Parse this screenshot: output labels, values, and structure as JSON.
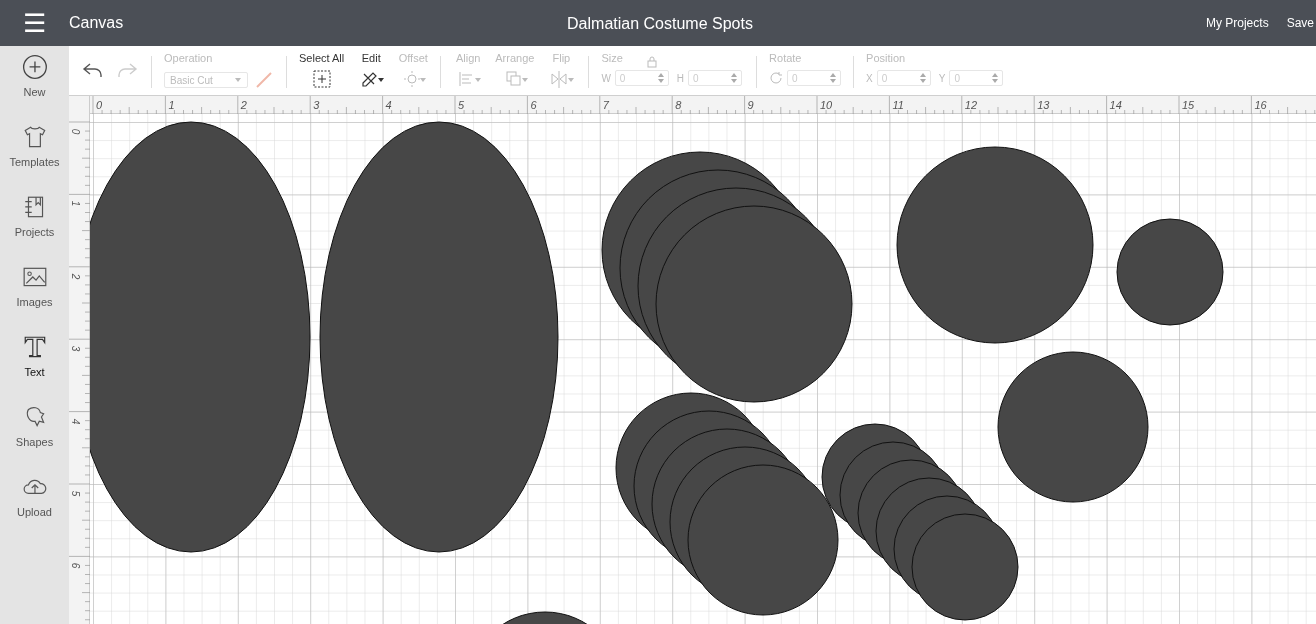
{
  "header": {
    "menu_icon": "☰",
    "section": "Canvas",
    "title": "Dalmatian Costume Spots",
    "links": [
      "My Projects",
      "Save"
    ]
  },
  "sidebar": {
    "items": [
      {
        "label": "New",
        "kind": "new",
        "selected": false
      },
      {
        "label": "Templates",
        "kind": "templates",
        "selected": false
      },
      {
        "label": "Projects",
        "kind": "projects",
        "selected": false
      },
      {
        "label": "Images",
        "kind": "images",
        "selected": false
      },
      {
        "label": "Text",
        "kind": "text",
        "selected": true
      },
      {
        "label": "Shapes",
        "kind": "shapes",
        "selected": false
      },
      {
        "label": "Upload",
        "kind": "upload",
        "selected": false
      }
    ]
  },
  "toolbar": {
    "operation": {
      "label": "Operation",
      "value": "Basic Cut",
      "disabled": true
    },
    "tools": [
      {
        "label": "Select All",
        "kind": "selectall",
        "disabled": false
      },
      {
        "label": "Edit",
        "kind": "edit",
        "disabled": false
      },
      {
        "label": "Offset",
        "kind": "offset",
        "disabled": true
      }
    ],
    "arrange": [
      {
        "label": "Align",
        "kind": "align",
        "disabled": true
      },
      {
        "label": "Arrange",
        "kind": "arrange",
        "disabled": true
      },
      {
        "label": "Flip",
        "kind": "flip",
        "disabled": true
      }
    ],
    "size": {
      "label": "Size",
      "fields": [
        {
          "label": "W",
          "value": "0"
        },
        {
          "label": "H",
          "value": "0"
        }
      ]
    },
    "rotate": {
      "label": "Rotate",
      "value": "0"
    },
    "position": {
      "label": "Position",
      "fields": [
        {
          "label": "X",
          "value": "0"
        },
        {
          "label": "Y",
          "value": "0"
        }
      ]
    }
  },
  "ruler": {
    "horizontal": [
      "0",
      "1",
      "2",
      "3",
      "4",
      "5",
      "6",
      "7",
      "8",
      "9",
      "10",
      "11",
      "12",
      "13",
      "14",
      "15",
      "16"
    ],
    "vertical": [
      "0",
      "1",
      "2",
      "3",
      "4",
      "5",
      "6"
    ]
  }
}
